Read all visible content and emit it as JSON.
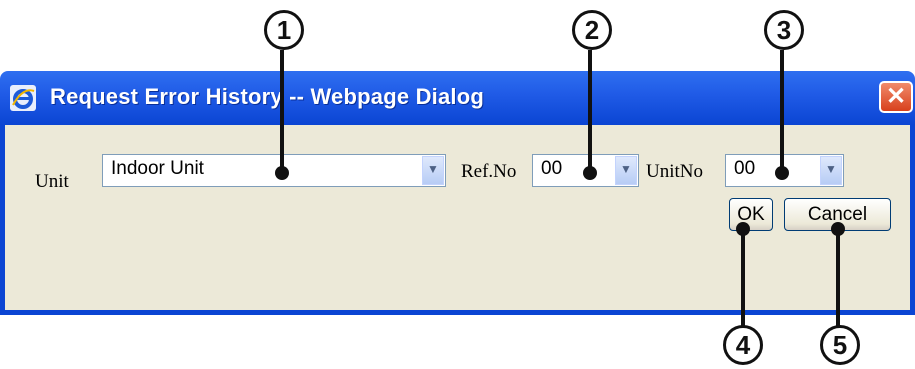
{
  "callouts": [
    "1",
    "2",
    "3",
    "4",
    "5"
  ],
  "window": {
    "title": "Request Error History -- Webpage Dialog",
    "close_glyph": "✕",
    "icon": "ie-icon"
  },
  "form": {
    "unit_label": "Unit",
    "unit_value": "Indoor Unit",
    "refno_label": "Ref.No",
    "refno_value": "00",
    "unitno_label": "UnitNo",
    "unitno_value": "00",
    "dropdown_glyph": "▼"
  },
  "buttons": {
    "ok_label": "OK",
    "cancel_label": "Cancel"
  },
  "colors": {
    "titlebar": "#1f5ae6",
    "dialog_bg": "#ece9d8",
    "close": "#d8401c"
  }
}
